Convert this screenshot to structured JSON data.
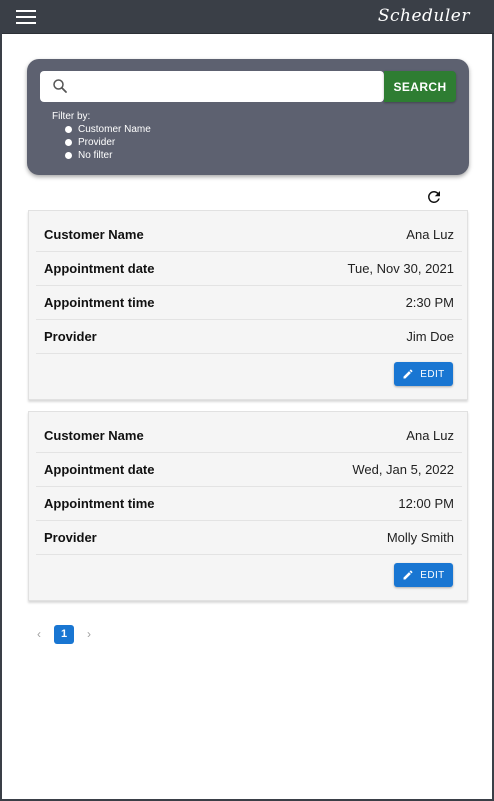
{
  "app": {
    "brand": "Scheduler"
  },
  "search": {
    "placeholder": "",
    "button_label": "SEARCH",
    "filter_label": "Filter by:",
    "filters": [
      "Customer Name",
      "Provider",
      "No filter"
    ]
  },
  "labels": {
    "customer_name": "Customer Name",
    "appointment_date": "Appointment date",
    "appointment_time": "Appointment time",
    "provider": "Provider",
    "edit": "EDIT"
  },
  "appointments": [
    {
      "customer_name": "Ana Luz",
      "date": "Tue, Nov 30, 2021",
      "time": "2:30 PM",
      "provider": "Jim Doe"
    },
    {
      "customer_name": "Ana Luz",
      "date": "Wed, Jan 5, 2022",
      "time": "12:00 PM",
      "provider": "Molly Smith"
    }
  ],
  "pagination": {
    "prev": "‹",
    "current": "1",
    "next": "›"
  },
  "colors": {
    "appbar": "#3a3f47",
    "panel": "#5d6170",
    "search_button": "#2e7d32",
    "accent": "#1976d2"
  },
  "icons": {
    "menu": "menu-icon",
    "search": "search-icon",
    "refresh": "refresh-icon",
    "edit": "pencil-icon"
  }
}
